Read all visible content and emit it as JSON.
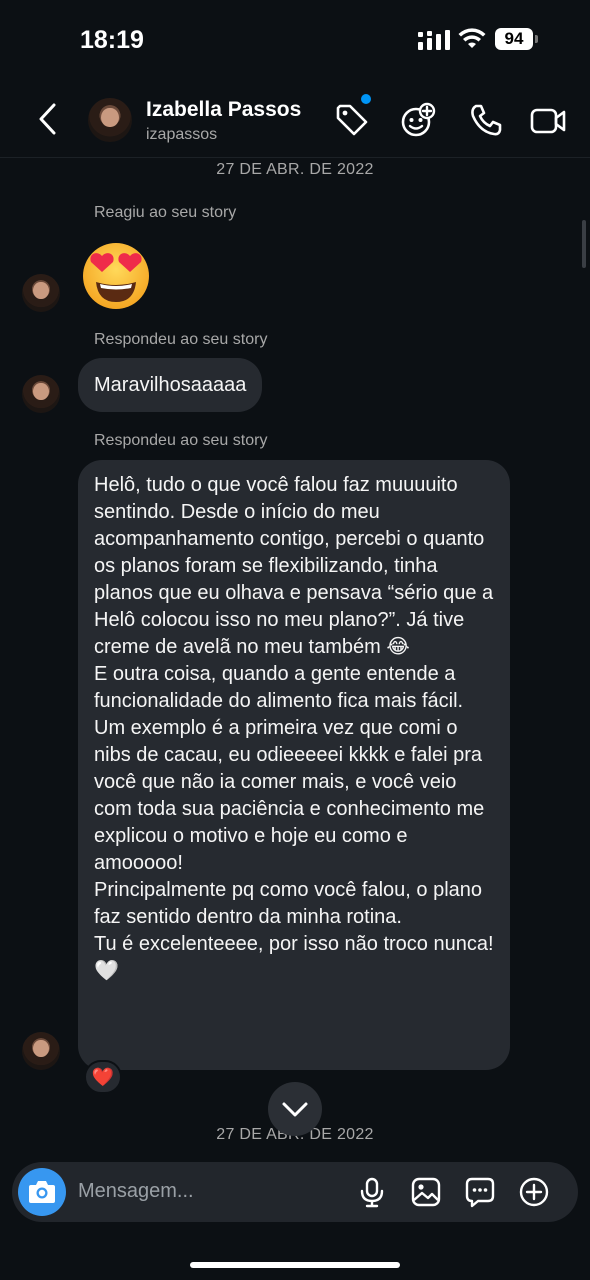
{
  "status_bar": {
    "time": "18:19",
    "battery": "94"
  },
  "header": {
    "contact_name": "Izabella Passos",
    "contact_handle": "izapassos"
  },
  "chat": {
    "date_top": "27 DE ABR. DE 2022",
    "reacted_label": "Reagiu ao seu story",
    "reaction_emoji": "heart-eyes",
    "replied_label_1": "Respondeu ao seu story",
    "message_1": "Maravilhosaaaaa",
    "replied_label_2": "Respondeu ao seu story",
    "message_2": "Helô, tudo o que você falou faz muuuuito sentindo. Desde o início do meu acompanhamento contigo, percebi o quanto os planos foram se flexibilizando, tinha planos que eu olhava e pensava “sério que a Helô colocou isso no meu plano?”. Já tive creme de avelã no meu também 😂\nE outra coisa, quando a gente entende a funcionalidade do alimento fica mais fácil. Um exemplo é a primeira vez que comi o nibs de cacau, eu odieeeeei kkkk e falei pra você que não ia comer mais, e você veio com toda sua paciência e conhecimento me explicou o motivo e hoje eu como e amooooo!\nPrincipalmente pq como você falou, o plano faz sentido dentro da minha rotina.\nTu é excelenteeee, por isso não troco nunca! 🤍",
    "message_reaction": "❤️",
    "date_bottom": "27 DE ABR. DE 2022"
  },
  "composer": {
    "placeholder": "Mensagem..."
  },
  "colors": {
    "background": "#0c1014",
    "bubble": "#262a30",
    "accent": "#3797f0",
    "notification_dot": "#0095f6"
  }
}
